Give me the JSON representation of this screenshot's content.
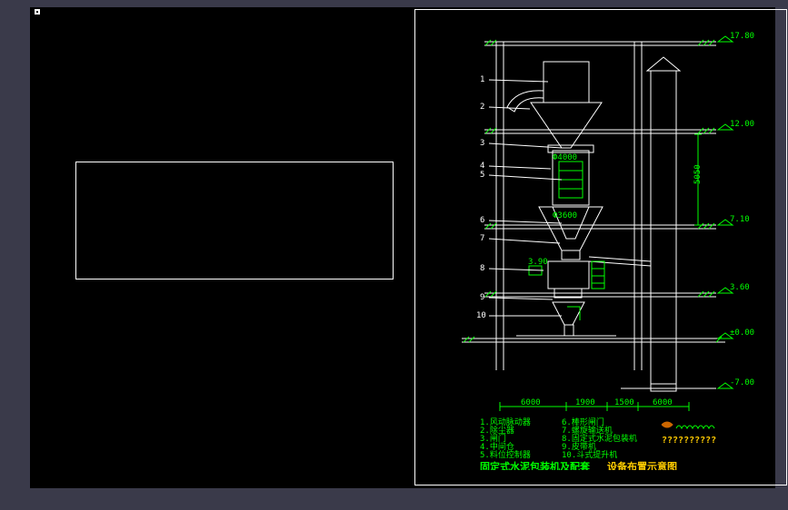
{
  "domain": "Diagram",
  "drawing": {
    "title_green": "固定式水泥包装机及配套",
    "title_yellow": "设备布置示意图",
    "callouts": [
      "1",
      "2",
      "3",
      "4",
      "5",
      "6",
      "7",
      "8",
      "9",
      "10"
    ],
    "legend_left": {
      "1": "1.风动脉动器",
      "2": "2.除尘器",
      "3": "3.闸门",
      "4": "4.中间仓",
      "5": "5.料位控制器"
    },
    "legend_right": {
      "6": "6.棒形闸门",
      "7": "7.螺旋输送机",
      "8": "8.固定式水泥包装机",
      "9": "9.皮带机",
      "10": "10.斗式提升机"
    },
    "elevations": {
      "e1": "17.80",
      "e2": "12.00",
      "e3": "7.10",
      "e4": "3.60",
      "e5": "±0.00",
      "e6": "-7.00"
    },
    "dims": {
      "d1": "6000",
      "d2": "1900",
      "d3": "1500",
      "d4": "6000",
      "dv": "5050",
      "h1": "Ф4000",
      "h2": "Ф3600",
      "h3": "3.90"
    },
    "stamp": "??????????"
  }
}
